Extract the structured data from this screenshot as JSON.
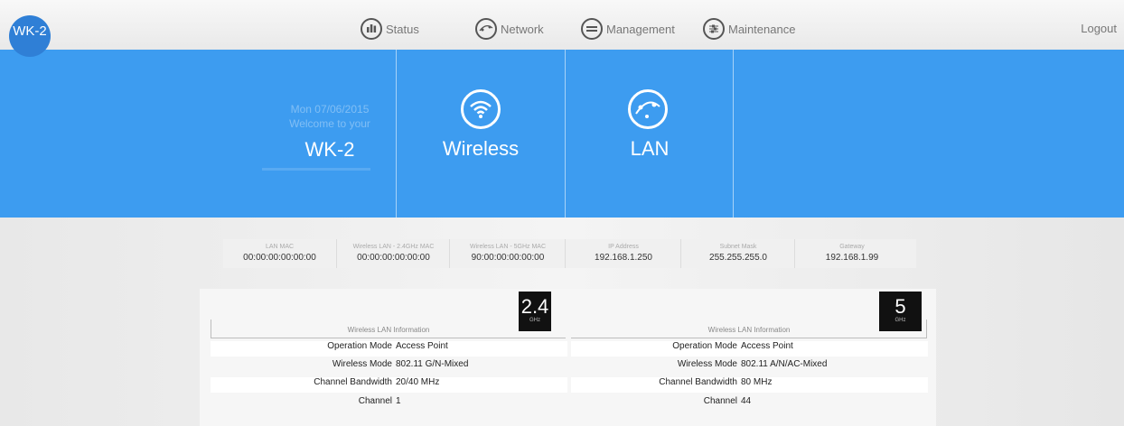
{
  "brand": "WK-2",
  "nav": [
    {
      "label": "Status",
      "icon": "status-bars-icon"
    },
    {
      "label": "Network",
      "icon": "network-globe-icon"
    },
    {
      "label": "Management",
      "icon": "management-menu-icon"
    },
    {
      "label": "Maintenance",
      "icon": "maintenance-sliders-icon"
    }
  ],
  "logout": "Logout",
  "hero": {
    "date": "Mon 07/06/2015",
    "welcome": "Welcome to your",
    "device": "WK-2",
    "tiles": [
      {
        "label": "Wireless",
        "icon": "wifi-icon"
      },
      {
        "label": "LAN",
        "icon": "lan-globe-icon"
      }
    ]
  },
  "info": [
    {
      "label": "LAN MAC",
      "value": "00:00:00:00:00:00"
    },
    {
      "label": "Wireless LAN - 2.4GHz MAC",
      "value": "00:00:00:00:00:00"
    },
    {
      "label": "Wireless LAN - 5GHz MAC",
      "value": "90:00:00:00:00:00"
    },
    {
      "label": "IP Address",
      "value": "192.168.1.250"
    },
    {
      "label": "Subnet Mask",
      "value": "255.255.255.0"
    },
    {
      "label": "Gateway",
      "value": "192.168.1.99"
    }
  ],
  "wireless": [
    {
      "title": "Wireless LAN Information",
      "band": "2.4",
      "unit": "GHz",
      "rows": [
        {
          "key": "Operation Mode",
          "value": "Access Point"
        },
        {
          "key": "Wireless Mode",
          "value": "802.11 G/N-Mixed"
        },
        {
          "key": "Channel Bandwidth",
          "value": "20/40 MHz"
        },
        {
          "key": "Channel",
          "value": "1"
        }
      ]
    },
    {
      "title": "Wireless LAN Information",
      "band": "5",
      "unit": "GHz",
      "rows": [
        {
          "key": "Operation Mode",
          "value": "Access Point"
        },
        {
          "key": "Wireless Mode",
          "value": "802.11 A/N/AC-Mixed"
        },
        {
          "key": "Channel Bandwidth",
          "value": "80 MHz"
        },
        {
          "key": "Channel",
          "value": "44"
        }
      ]
    }
  ],
  "colors": {
    "accent": "#3d9cf0",
    "logo": "#2f7fd6"
  }
}
